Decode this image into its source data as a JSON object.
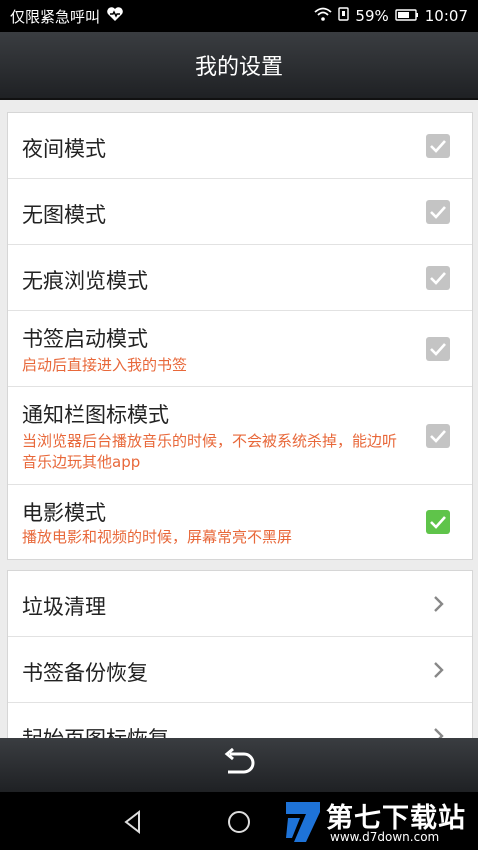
{
  "status_bar": {
    "carrier": "仅限紧急呼叫",
    "battery": "59%",
    "time": "10:07"
  },
  "header": {
    "title": "我的设置"
  },
  "toggles": [
    {
      "title": "夜间模式",
      "desc": "",
      "checked": false
    },
    {
      "title": "无图模式",
      "desc": "",
      "checked": false
    },
    {
      "title": "无痕浏览模式",
      "desc": "",
      "checked": false
    },
    {
      "title": "书签启动模式",
      "desc": "启动后直接进入我的书签",
      "checked": false
    },
    {
      "title": "通知栏图标模式",
      "desc": "当浏览器后台播放音乐的时候，不会被系统杀掉，能边听音乐边玩其他app",
      "checked": false
    },
    {
      "title": "电影模式",
      "desc": "播放电影和视频的时候，屏幕常亮不黑屏",
      "checked": true
    }
  ],
  "links": [
    {
      "title": "垃圾清理"
    },
    {
      "title": "书签备份恢复"
    },
    {
      "title": "起始页图标恢复"
    }
  ],
  "colors": {
    "checked": "#5fc44a",
    "unchecked": "#c4c4c4",
    "description": "#e8683a"
  },
  "watermark": {
    "text": "第七下载站",
    "url": "www.d7down.com"
  }
}
